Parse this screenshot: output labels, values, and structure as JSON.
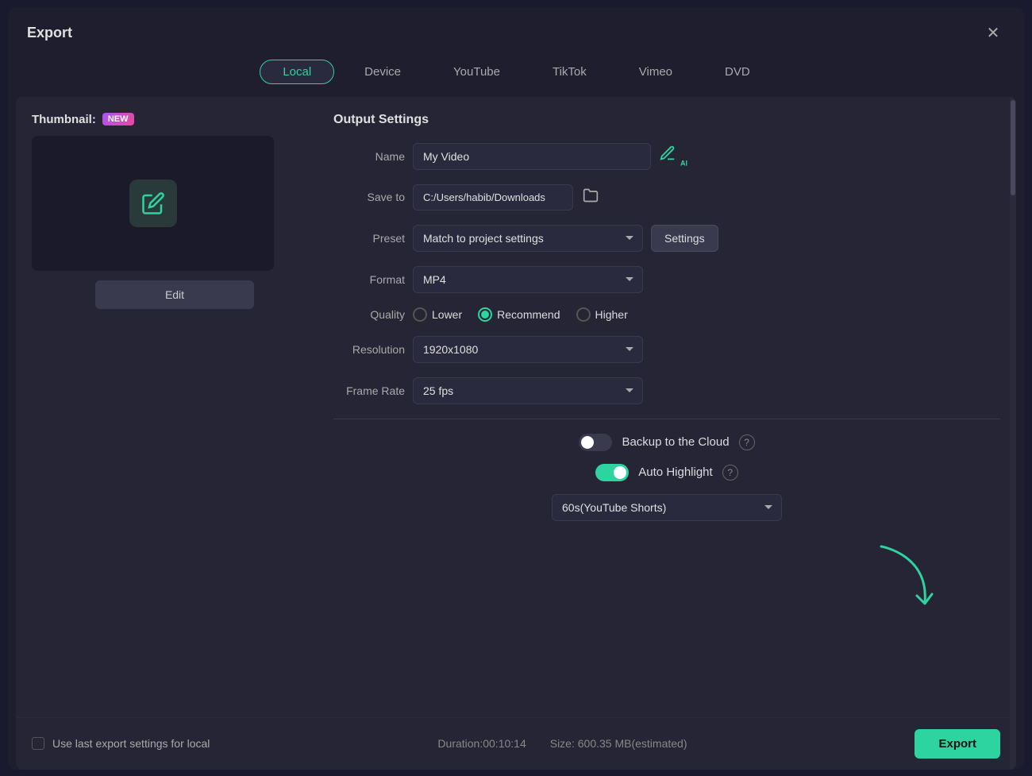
{
  "dialog": {
    "title": "Export",
    "close_label": "✕"
  },
  "tabs": [
    {
      "id": "local",
      "label": "Local",
      "active": true
    },
    {
      "id": "device",
      "label": "Device",
      "active": false
    },
    {
      "id": "youtube",
      "label": "YouTube",
      "active": false
    },
    {
      "id": "tiktok",
      "label": "TikTok",
      "active": false
    },
    {
      "id": "vimeo",
      "label": "Vimeo",
      "active": false
    },
    {
      "id": "dvd",
      "label": "DVD",
      "active": false
    }
  ],
  "thumbnail": {
    "label": "Thumbnail:",
    "new_badge": "NEW",
    "edit_btn": "Edit"
  },
  "output": {
    "title": "Output Settings",
    "name_label": "Name",
    "name_value": "My Video",
    "save_label": "Save to",
    "save_path": "C:/Users/habib/Downloads",
    "preset_label": "Preset",
    "preset_value": "Match to project settings",
    "settings_btn": "Settings",
    "format_label": "Format",
    "format_value": "MP4",
    "quality_label": "Quality",
    "quality_options": [
      {
        "label": "Lower",
        "checked": false
      },
      {
        "label": "Recommend",
        "checked": true
      },
      {
        "label": "Higher",
        "checked": false
      }
    ],
    "resolution_label": "Resolution",
    "resolution_value": "1920x1080",
    "framerate_label": "Frame Rate",
    "framerate_value": "25 fps",
    "cloud_backup_label": "Backup to the Cloud",
    "cloud_backup_on": false,
    "auto_highlight_label": "Auto Highlight",
    "auto_highlight_on": true,
    "shorts_value": "60s(YouTube Shorts)"
  },
  "footer": {
    "use_last_label": "Use last export settings for local",
    "duration_label": "Duration:00:10:14",
    "size_label": "Size: 600.35 MB(estimated)",
    "export_btn": "Export"
  }
}
